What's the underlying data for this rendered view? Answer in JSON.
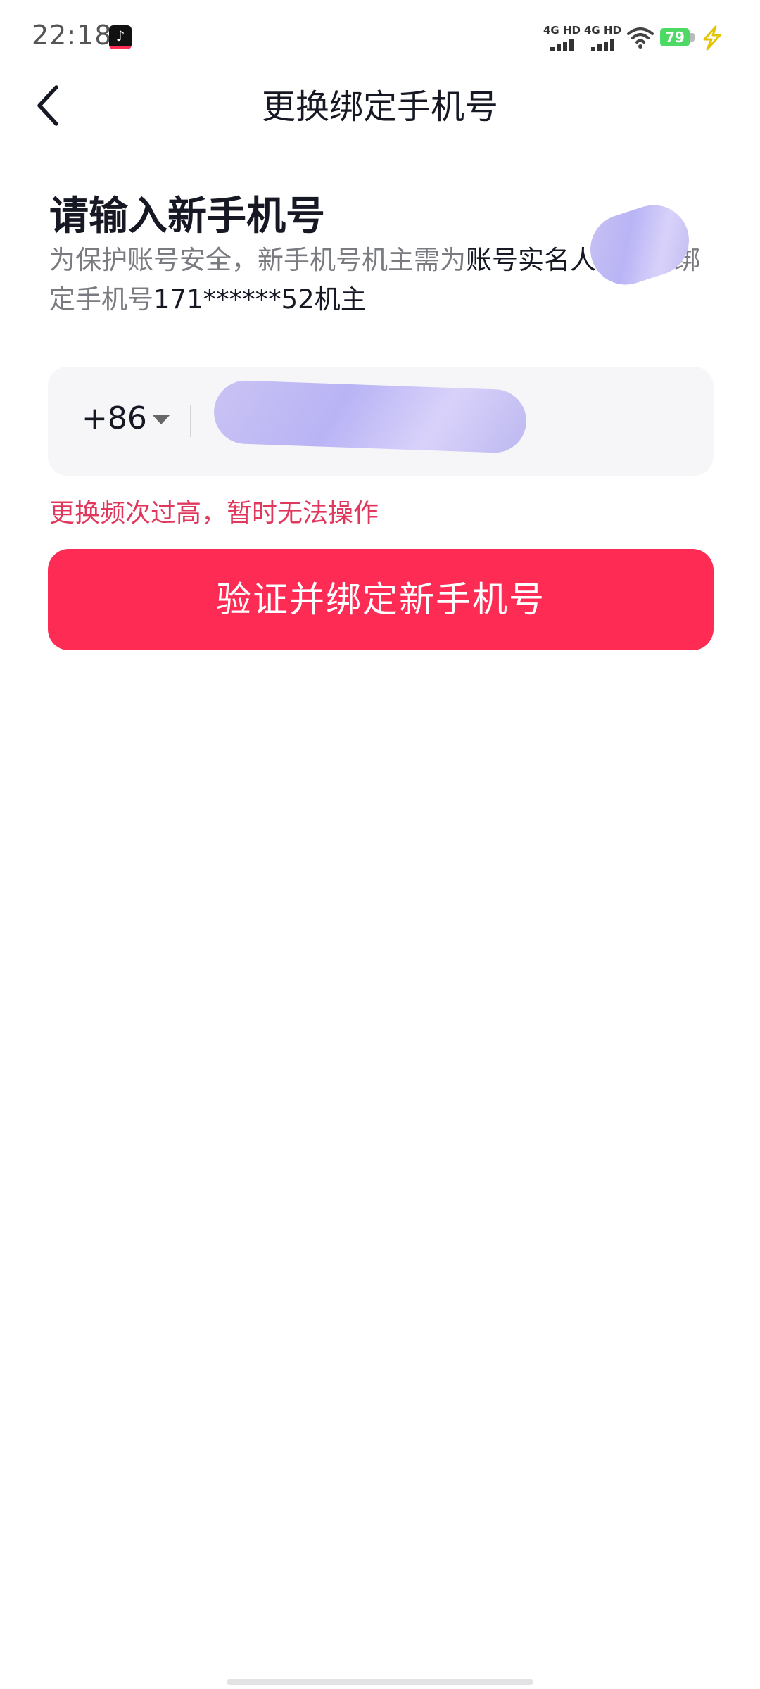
{
  "status_bar": {
    "time": "22:18",
    "app_icon": "tiktok-icon",
    "sim1_label": "4G HD",
    "sim2_label": "4G HD",
    "battery_level": "79",
    "wifi_icon": "wifi-icon",
    "charging_icon": "charging-bolt-icon"
  },
  "nav": {
    "back_icon": "chevron-left-icon",
    "title": "更换绑定手机号"
  },
  "main": {
    "heading": "请输入新手机号",
    "desc_part1": "为保护账号安全，新手机号机主需为",
    "desc_highlight": "账号实名人",
    "desc_part2": "或当前绑定手机号",
    "desc_masked_phone": "171******52",
    "desc_part3": "机主",
    "country_code": "+86",
    "phone_input_value": "",
    "phone_input_placeholder": "",
    "error_message": "更换频次过高，暂时无法操作",
    "submit_label": "验证并绑定新手机号"
  },
  "colors": {
    "accent": "#fe2c55",
    "error": "#e0385d",
    "text_primary": "#161823",
    "text_secondary": "#7a7b80",
    "input_bg": "#f6f6f8"
  }
}
